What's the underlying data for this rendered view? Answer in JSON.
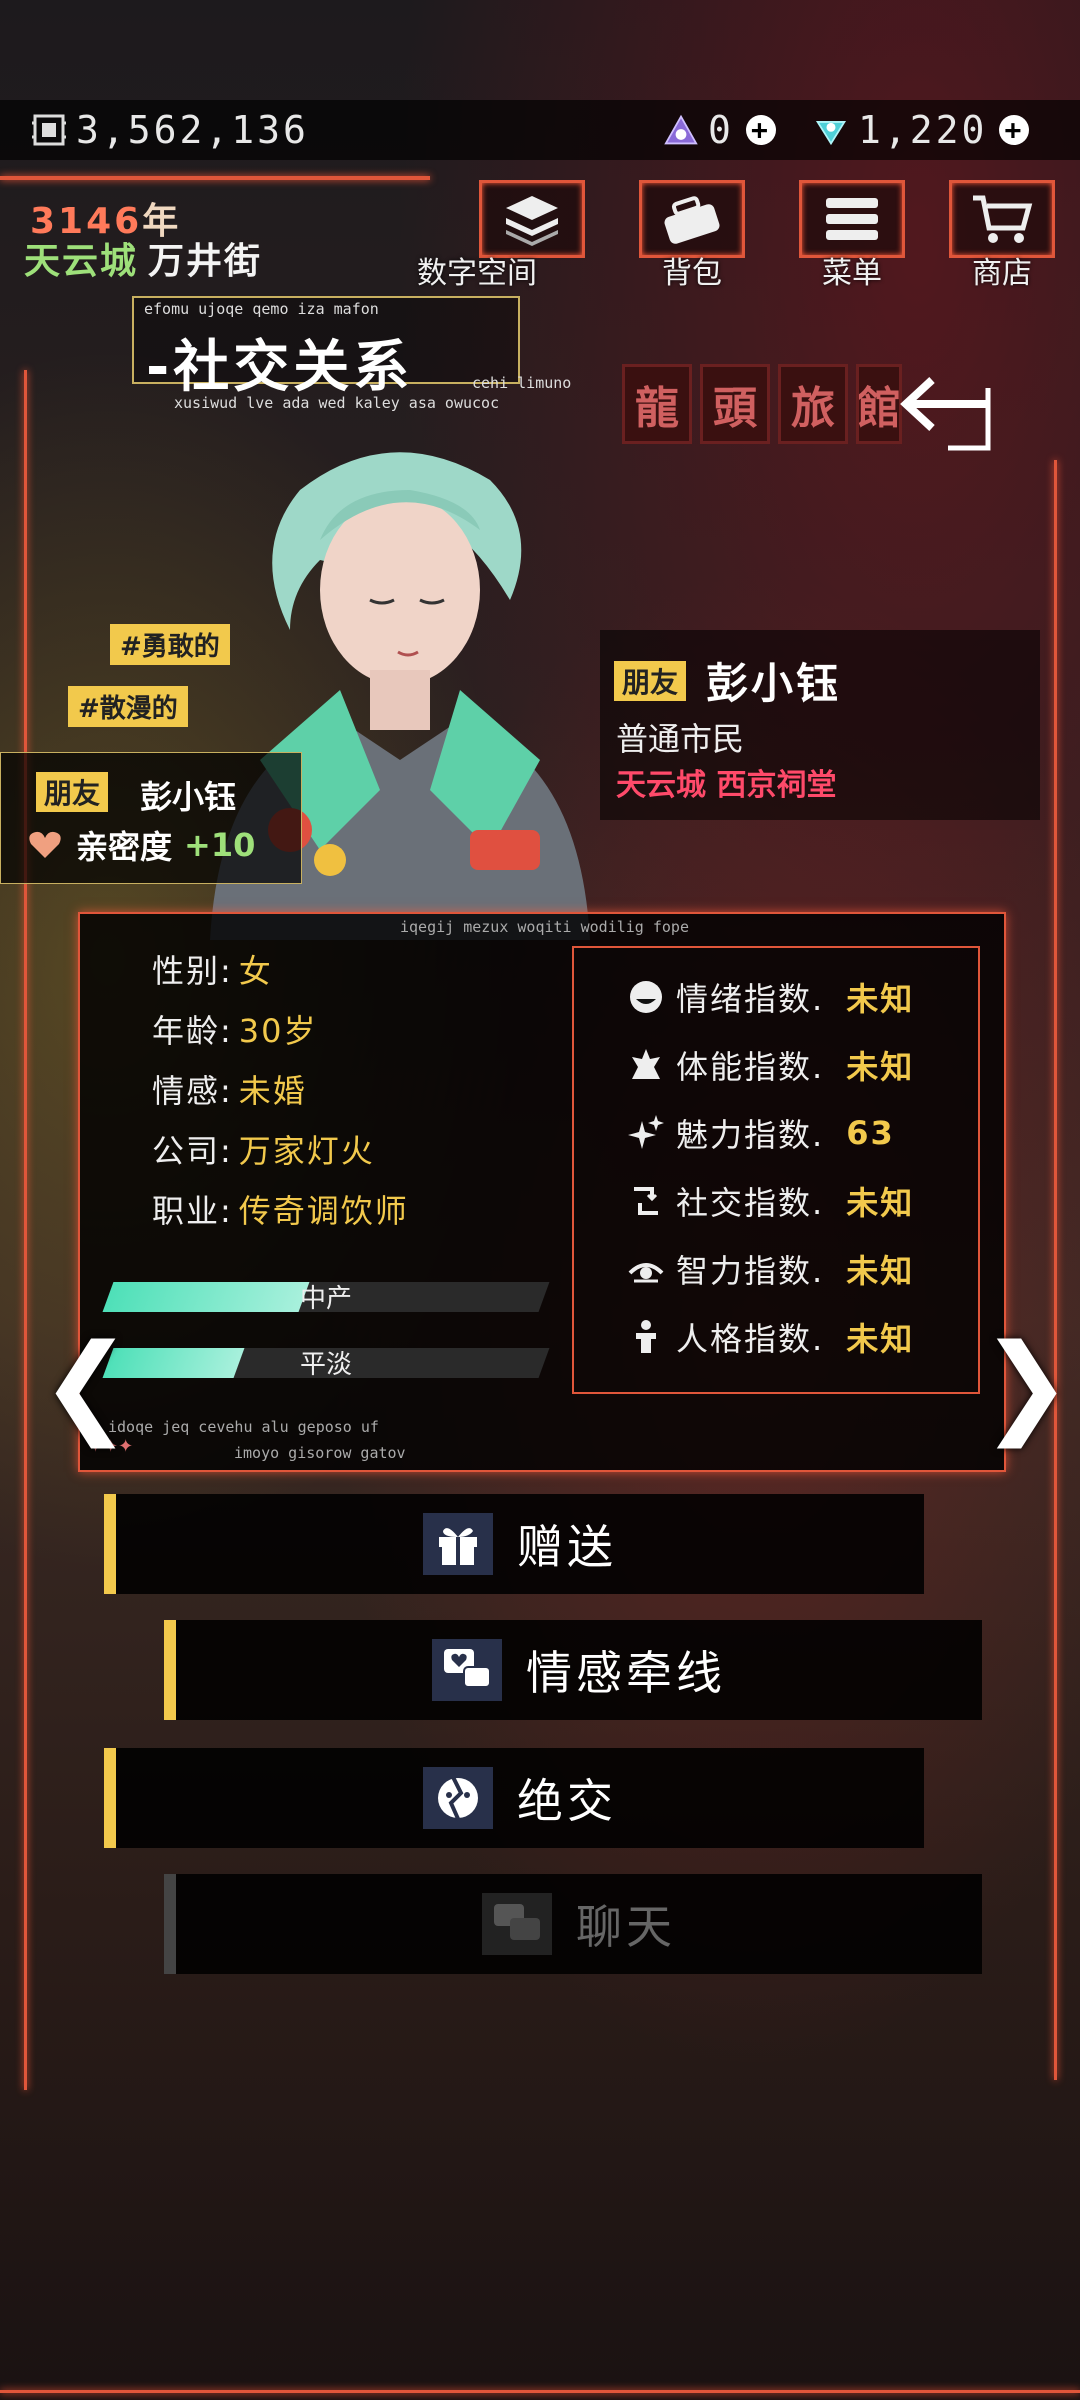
{
  "currency": {
    "coins": "3,562,136",
    "gems": "0",
    "crystals": "1,220"
  },
  "header": {
    "year": "3146",
    "year_suffix": "年",
    "city": "天云城",
    "street": "万井街"
  },
  "menu": [
    {
      "label": "数字空间",
      "icon": "digital-space-icon"
    },
    {
      "label": "背包",
      "icon": "bag-icon"
    },
    {
      "label": "菜单",
      "icon": "menu-icon"
    },
    {
      "label": "商店",
      "icon": "shop-cart-icon"
    }
  ],
  "title": {
    "main": "-社交关系",
    "sub_top": "efomu ujoqe qemo iza mafon",
    "sub_bottom": "xusiwud lve ada wed kaley asa owucoc",
    "sub_right": "cehi limuno"
  },
  "tags": [
    "#勇敢的",
    "#散漫的"
  ],
  "friend": {
    "relation": "朋友",
    "name": "彭小钰",
    "intimacy_label": "亲密度",
    "intimacy_value": "+10",
    "occupation_class": "普通市民",
    "location": "天云城 西京祠堂"
  },
  "stats_panel": {
    "code_top": "iqegij mezux woqiti wodilig fope",
    "code_bottom1": "idoqe jeq cevehu alu geposo uf",
    "code_bottom2": "imoyo gisorow gatov",
    "attributes": [
      {
        "label": "性别:",
        "value": "女"
      },
      {
        "label": "年龄:",
        "value": "30岁"
      },
      {
        "label": "情感:",
        "value": "未婚"
      },
      {
        "label": "公司:",
        "value": "万家灯火"
      },
      {
        "label": "职业:",
        "value": "传奇调饮师"
      }
    ],
    "bars": [
      {
        "label": "中产",
        "level": 0.45
      },
      {
        "label": "平淡",
        "level": 0.3
      }
    ],
    "indices": [
      {
        "label": "情绪指数.",
        "value": "未知",
        "icon": "emotion-icon"
      },
      {
        "label": "体能指数.",
        "value": "未知",
        "icon": "stamina-icon"
      },
      {
        "label": "魅力指数.",
        "value": "63",
        "icon": "charm-sparkle-icon"
      },
      {
        "label": "社交指数.",
        "value": "未知",
        "icon": "social-icon"
      },
      {
        "label": "智力指数.",
        "value": "未知",
        "icon": "intelligence-eye-icon"
      },
      {
        "label": "人格指数.",
        "value": "未知",
        "icon": "personality-person-icon"
      }
    ]
  },
  "actions": [
    {
      "label": "赠送",
      "icon": "gift-icon",
      "enabled": true
    },
    {
      "label": "情感牵线",
      "icon": "chat-heart-icon",
      "enabled": true
    },
    {
      "label": "绝交",
      "icon": "break-mask-icon",
      "enabled": true
    },
    {
      "label": "聊天",
      "icon": "chat-icon",
      "enabled": false
    }
  ],
  "background_signs": {
    "sign1": "龍",
    "sign2": "頭",
    "sign3": "旅",
    "sign4": "館"
  },
  "colors": {
    "accent_red": "#e0563a",
    "accent_yellow": "#f2c94c",
    "accent_green": "#9ee07a",
    "location_pink": "#ff4a6a",
    "bar_teal": "#4ee0b8"
  }
}
